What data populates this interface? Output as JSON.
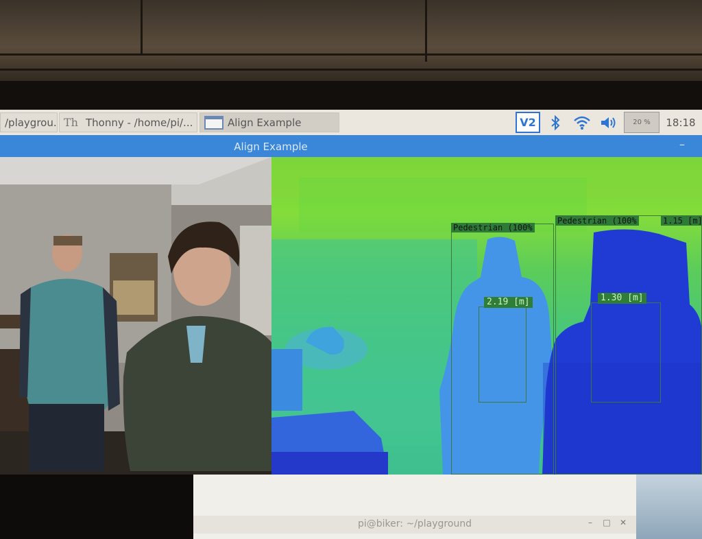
{
  "taskbar": {
    "tasks": [
      {
        "label": "/playgrou..."
      },
      {
        "label": "Thonny  -  /home/pi/..."
      },
      {
        "label": "Align Example"
      }
    ],
    "tray": {
      "vnc_label": "V2",
      "cpu_label": "20 %",
      "clock": "18:18"
    }
  },
  "window": {
    "title": "Align Example"
  },
  "detections": [
    {
      "class_label": "Pedestrian (100%",
      "distance_label": "2.19 [m]",
      "distance_m": 2.19
    },
    {
      "class_label": "Pedestrian (100%",
      "secondary_label": "1.15 [m]",
      "distance_label": "1.30 [m]",
      "distance_m": 1.3
    }
  ],
  "terminal": {
    "title": "pi@biker: ~/playground"
  },
  "colors": {
    "titlebar": "#3a87d9",
    "taskbar": "#ebe7df",
    "depth_far": "#7fd43c",
    "depth_near": "#1a2fd9",
    "detection_box": "#2e7a37"
  }
}
